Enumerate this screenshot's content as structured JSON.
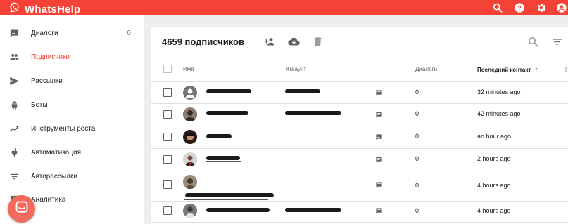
{
  "app": {
    "name": "WhatsHelp"
  },
  "sidebar": {
    "items": [
      {
        "label": "Диалоги",
        "count": "0"
      },
      {
        "label": "Подписчики"
      },
      {
        "label": "Рассылки"
      },
      {
        "label": "Боты"
      },
      {
        "label": "Инструменты роста"
      },
      {
        "label": "Автоматизация"
      },
      {
        "label": "Авторассылки"
      },
      {
        "label": "Аналитика"
      }
    ]
  },
  "main": {
    "title": "4659 подписчиков",
    "columns": {
      "name": "Имя",
      "account": "Аккаунт",
      "dialogs": "Диалоги",
      "last_contact": "Последний контакт",
      "sort_arrow": "↑"
    },
    "rows": [
      {
        "dialogs": "0",
        "last_contact": "32 minutes ago"
      },
      {
        "dialogs": "0",
        "last_contact": "42 minutes ago"
      },
      {
        "dialogs": "0",
        "last_contact": "an hour ago"
      },
      {
        "dialogs": "0",
        "last_contact": "2 hours ago"
      },
      {
        "dialogs": "0",
        "last_contact": "4 hours ago"
      },
      {
        "dialogs": "0",
        "last_contact": "4 hours ago"
      }
    ]
  },
  "colors": {
    "brand": "#f44336",
    "chat_button": "#f26b5d",
    "background": "#eeeeee"
  }
}
